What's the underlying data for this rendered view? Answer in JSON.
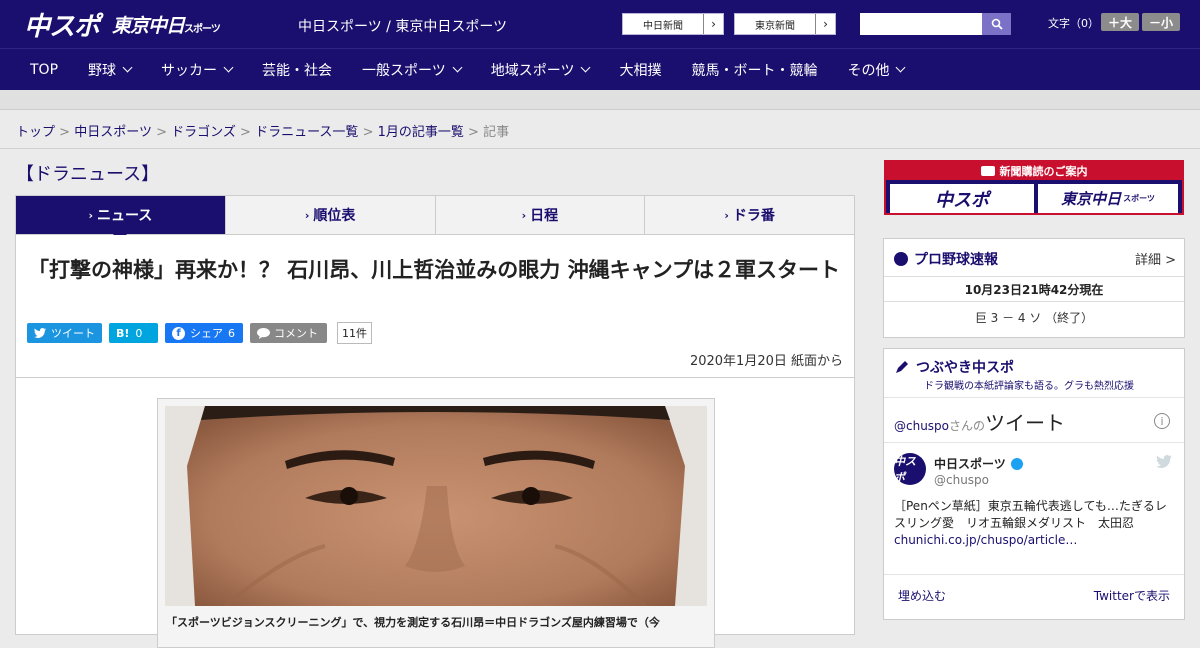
{
  "header": {
    "logo_chuspo": "中スポ",
    "logo_tokyo": "東京中日",
    "logo_tokyo_small": "スポーツ",
    "site_title": "中日スポーツ / 東京中日スポーツ",
    "btn_chunichi": "中日新聞",
    "btn_tokyo": "東京新聞",
    "search_placeholder": "",
    "fontsize_label": "文字（0）",
    "font_bigger": "＋大",
    "font_smaller": "－小"
  },
  "nav": {
    "items": [
      {
        "label": "TOP",
        "chev": false
      },
      {
        "label": "野球",
        "chev": true
      },
      {
        "label": "サッカー",
        "chev": true
      },
      {
        "label": "芸能・社会",
        "chev": false
      },
      {
        "label": "一般スポーツ",
        "chev": true
      },
      {
        "label": "地域スポーツ",
        "chev": true
      },
      {
        "label": "大相撲",
        "chev": false
      },
      {
        "label": "競馬・ボート・競輪",
        "chev": false
      },
      {
        "label": "その他",
        "chev": true
      }
    ]
  },
  "breadcrumb": {
    "items": [
      "トップ",
      "中日スポーツ",
      "ドラゴンズ",
      "ドラニュース一覧",
      "1月の記事一覧"
    ],
    "current": "記事",
    "sep": ">"
  },
  "section_title": "【ドラニュース】",
  "tabs": [
    {
      "label": "ニュース",
      "active": true
    },
    {
      "label": "順位表",
      "active": false
    },
    {
      "label": "日程",
      "active": false
    },
    {
      "label": "ドラ番",
      "active": false
    }
  ],
  "article": {
    "headline": "「打撃の神様」再来か！？ 石川昂、川上哲治並みの眼力 沖縄キャンプは２軍スタート",
    "tweet_label": "ツイート",
    "hatena_label": "B!",
    "hatena_count": "0",
    "share_label": "シェア",
    "share_count": "6",
    "comment_label": "コメント",
    "comment_count": "11件",
    "dateline": "2020年1月20日 紙面から",
    "caption": "「スポーツビジョンスクリーニング」で、視力を測定する石川昂＝中日ドラゴンズ屋内練習場で（今"
  },
  "sidebar": {
    "ad_title": "新聞購読のご案内",
    "ad_logo_left": "中スポ",
    "ad_logo_right": "東京中日",
    "ad_logo_right_small": "スポーツ",
    "baseball": {
      "title": "プロ野球速報",
      "more": "詳細 >",
      "time": "10月23日21時42分現在",
      "score": "巨 3 － 4 ソ （終了）"
    },
    "twitter": {
      "title": "つぶやき中スポ",
      "subtitle": "ドラ観戦の本紙評論家も語る。グラも熱烈応援",
      "handle": "@chuspo",
      "handle_suffix": "さんの",
      "handle_big": "ツイート",
      "avatar_text": "中スポ",
      "name": "中日スポーツ",
      "user": "@chuspo",
      "text": "［Penペン草紙］東京五輪代表逃しても…たぎるレスリング愛　リオ五輪銀メダリスト　太田忍",
      "link": "chunichi.co.jp/chuspo/article…",
      "embed": "埋め込む",
      "view": "Twitterで表示"
    }
  },
  "colors": {
    "brand": "#1a0f6e",
    "accent_red": "#c8102e",
    "twitter": "#1b95e0",
    "facebook": "#1877f2"
  }
}
